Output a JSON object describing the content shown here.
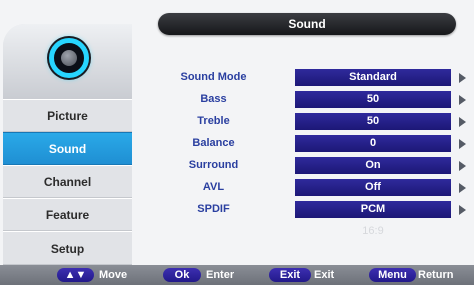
{
  "header": {
    "title": "Sound"
  },
  "sidebar": {
    "logo_icon": "ring-logo",
    "items": [
      {
        "label": "Picture",
        "active": false
      },
      {
        "label": "Sound",
        "active": true
      },
      {
        "label": "Channel",
        "active": false
      },
      {
        "label": "Feature",
        "active": false
      },
      {
        "label": "Setup",
        "active": false
      }
    ]
  },
  "settings": [
    {
      "label": "Sound Mode",
      "value": "Standard"
    },
    {
      "label": "Bass",
      "value": "50"
    },
    {
      "label": "Treble",
      "value": "50"
    },
    {
      "label": "Balance",
      "value": "0"
    },
    {
      "label": "Surround",
      "value": "On"
    },
    {
      "label": "AVL",
      "value": "Off"
    },
    {
      "label": "SPDIF",
      "value": "PCM"
    },
    {
      "label": "",
      "value": "16:9"
    }
  ],
  "help": {
    "move_key": "▲▼",
    "move_label": "Move",
    "enter_key": "Ok",
    "enter_label": "Enter",
    "exit_key": "Exit",
    "exit_label": "Exit",
    "menu_key": "Menu",
    "menu_label": "Return"
  },
  "colors": {
    "accent": "#1f8fd3",
    "value_bg": "#1c1776",
    "label_text": "#2a3fa0",
    "logo_ring": "#27d5ff"
  }
}
